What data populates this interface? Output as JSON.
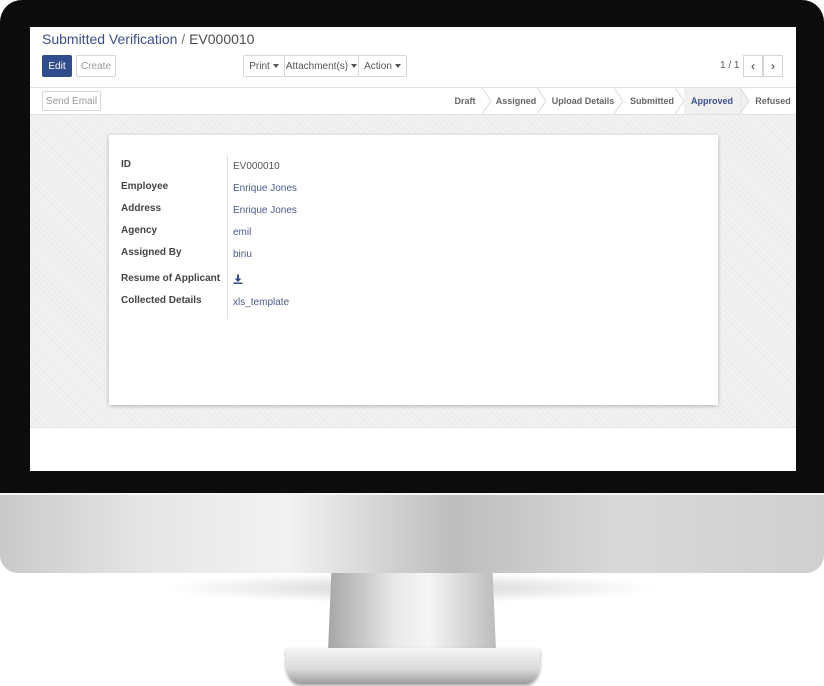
{
  "breadcrumb": {
    "parent": "Submitted Verification",
    "separator": "/",
    "current": "EV000010"
  },
  "toolbar": {
    "edit_label": "Edit",
    "create_label": "Create",
    "print_label": "Print",
    "attachments_label": "Attachment(s)",
    "action_label": "Action",
    "send_email_label": "Send Email"
  },
  "pager": {
    "text": "1 / 1",
    "prev_glyph": "‹",
    "next_glyph": "›"
  },
  "stages": [
    {
      "label": "Draft",
      "active": false
    },
    {
      "label": "Assigned",
      "active": false
    },
    {
      "label": "Upload Details",
      "active": false
    },
    {
      "label": "Submitted",
      "active": false
    },
    {
      "label": "Approved",
      "active": true
    },
    {
      "label": "Refused",
      "active": false
    }
  ],
  "form": {
    "fields": [
      {
        "label": "ID",
        "value": "EV000010"
      },
      {
        "label": "Employee",
        "value": "Enrique Jones"
      },
      {
        "label": "Address",
        "value": "Enrique Jones"
      },
      {
        "label": "Agency",
        "value": "emil"
      },
      {
        "label": "Assigned By",
        "value": "binu"
      },
      {
        "label": "Resume of Applicant",
        "value": ""
      },
      {
        "label": "Collected Details",
        "value": "xls_template"
      }
    ],
    "resume_icon": "download-icon"
  },
  "colors": {
    "primary": "#2f4d8c",
    "link": "#4a5a8f",
    "active_stage": "#3a4f8f"
  }
}
